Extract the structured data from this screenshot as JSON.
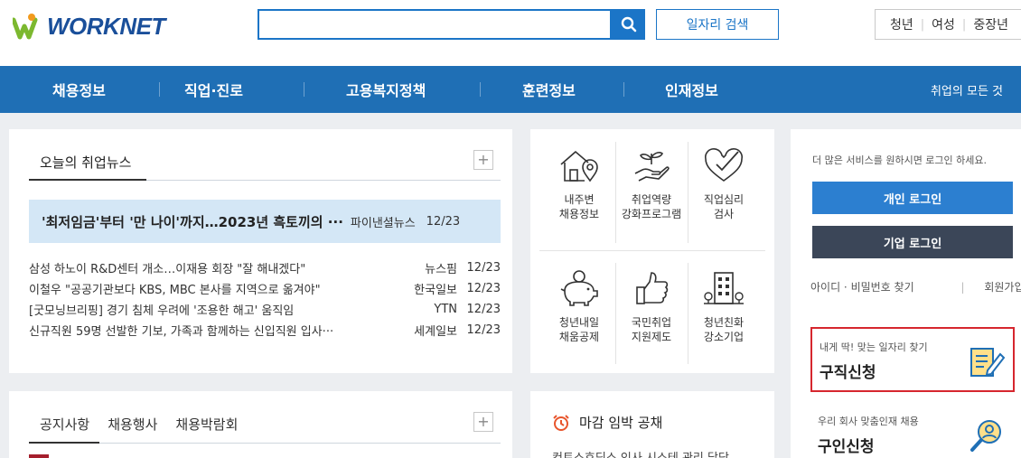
{
  "header": {
    "logo": "WORKNET",
    "search": {
      "value": "",
      "placeholder": ""
    },
    "job_search_label": "일자리 검색",
    "quick_links": [
      "청년",
      "여성",
      "중장년"
    ]
  },
  "nav": {
    "items": [
      "채용정보",
      "직업·진로",
      "고용복지정책",
      "훈련정보",
      "인재정보"
    ],
    "right_label": "취업의 모든 것"
  },
  "news": {
    "title": "오늘의 취업뉴스",
    "headline": {
      "title": "'최저임금'부터 '만 나이'까지…2023년 흑토끼의 ···",
      "source": "파이낸셜뉴스",
      "date": "12/23"
    },
    "items": [
      {
        "title": "삼성 하노이 R&D센터 개소…이재용 회장 \"잘 해내겠다\"",
        "source": "뉴스핌",
        "date": "12/23"
      },
      {
        "title": "이철우 \"공공기관보다 KBS, MBC 본사를 지역으로 옮겨야\"",
        "source": "한국일보",
        "date": "12/23"
      },
      {
        "title": "[굿모닝브리핑] 경기 침체 우려에 '조용한 해고' 움직임",
        "source": "YTN",
        "date": "12/23"
      },
      {
        "title": "신규직원 59명 선발한 기보, 가족과 함께하는 신입직원 입사···",
        "source": "세계일보",
        "date": "12/23"
      }
    ],
    "more_label": "+"
  },
  "services": [
    {
      "label": "내주변\n채용정보",
      "icon": "house-location-icon"
    },
    {
      "label": "취업역량\n강화프로그램",
      "icon": "hand-sprout-icon"
    },
    {
      "label": "직업심리\n검사",
      "icon": "heart-check-icon"
    },
    {
      "label": "청년내일\n채움공제",
      "icon": "piggy-bank-icon"
    },
    {
      "label": "국민취업\n지원제도",
      "icon": "thumbs-up-icon"
    },
    {
      "label": "청년친화\n강소기업",
      "icon": "building-icon"
    }
  ],
  "notice": {
    "tabs": [
      "공지사항",
      "채용행사",
      "채용박람회"
    ],
    "more_label": "+"
  },
  "deadline": {
    "title": "마감 임박 공채",
    "first_item": "컨트스호딩스 인사 시스테 관리 닫당"
  },
  "login": {
    "message": "더 많은 서비스를 원하시면 로그인 하세요.",
    "personal_label": "개인 로그인",
    "company_label": "기업 로그인",
    "find_label": "아이디 · 비밀번호 찾기",
    "join_label": "회원가입"
  },
  "promos": {
    "apply": {
      "small": "내게 딱! 맞는 일자리 찾기",
      "big": "구직신청"
    },
    "hire": {
      "small": "우리 회사 맞춤인재 채용",
      "big": "구인신청"
    }
  },
  "colors": {
    "nav": "#1f6fb5",
    "accent": "#2c7fd0",
    "company_btn": "#3b4658",
    "highlight_border": "#d6262e",
    "headline_bg": "#d4e7f6"
  }
}
